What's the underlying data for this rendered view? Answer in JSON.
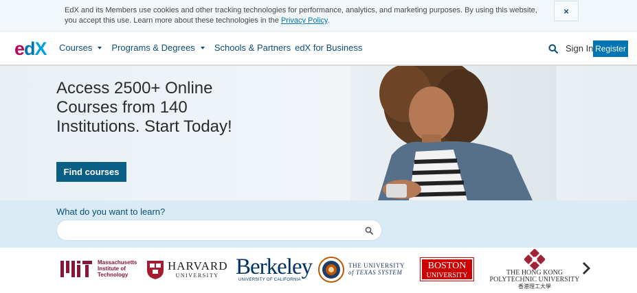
{
  "cookie": {
    "text": "EdX and its Members use cookies and other tracking technologies for performance, analytics, and marketing purposes. By using this website, you accept this use. Learn more about these technologies in the",
    "link": "Privacy Policy",
    "end": ".",
    "close": "×"
  },
  "header": {
    "logo": {
      "e": "e",
      "d": "d",
      "x": "X"
    },
    "nav": [
      {
        "label": "Courses",
        "dropdown": true
      },
      {
        "label": "Programs & Degrees",
        "dropdown": true
      },
      {
        "label": "Schools & Partners",
        "dropdown": false
      },
      {
        "label": "edX for Business",
        "dropdown": false
      }
    ],
    "signin": "Sign In",
    "register": "Register"
  },
  "hero": {
    "title": "Access 2500+ Online Courses from 140 Institutions. Start Today!",
    "cta": "Find courses"
  },
  "search": {
    "label": "What do you want to learn?",
    "placeholder": ""
  },
  "partners": {
    "mit": {
      "line1": "Massachusetts",
      "line2": "Institute of",
      "line3": "Technology"
    },
    "harvard": {
      "line1": "HARVARD",
      "line2": "UNIVERSITY"
    },
    "berkeley": {
      "line1": "Berkeley",
      "line2": "UNIVERSITY OF CALIFORNIA"
    },
    "texas": {
      "line1": "THE UNIVERSITY",
      "line2": "of TEXAS SYSTEM"
    },
    "boston": {
      "line1": "BOSTON",
      "line2": "UNIVERSITY"
    },
    "hongkong": {
      "line1": "THE HONG KONG",
      "line2": "POLYTECHNIC UNIVERSITY",
      "line3": "香港理工大學"
    }
  },
  "colors": {
    "brand_blue": "#0075b4",
    "brand_red": "#b5075c",
    "cta": "#0b5e84"
  }
}
